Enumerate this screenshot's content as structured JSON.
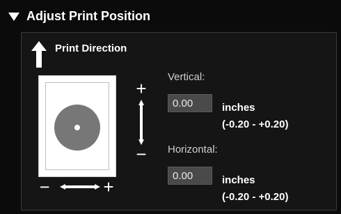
{
  "section": {
    "title": "Adjust Print Position"
  },
  "print_direction": {
    "label": "Print Direction"
  },
  "controls": {
    "vertical_plus": "+",
    "vertical_minus": "−",
    "horizontal_minus": "−",
    "horizontal_plus": "+"
  },
  "vertical": {
    "label": "Vertical:",
    "value": "0.00",
    "unit": "inches",
    "range": "(-0.20 - +0.20)"
  },
  "horizontal": {
    "label": "Horizontal:",
    "value": "0.00",
    "unit": "inches",
    "range": "(-0.20 - +0.20)"
  },
  "colors": {
    "background": "#0b0b0b",
    "frame": "#151515",
    "input_bg": "#4a4a4a",
    "disc": "#777777"
  }
}
